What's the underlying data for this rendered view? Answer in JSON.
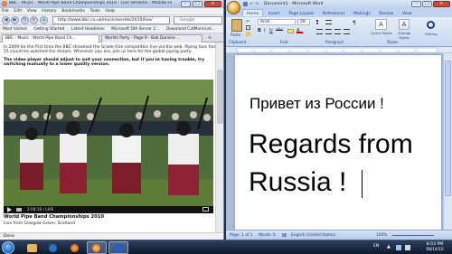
{
  "firefox": {
    "title": "BBC - Music - World Pipe Band Championships 2010 - Live Streams - Mozilla Firefox",
    "menu": [
      "File",
      "Edit",
      "View",
      "History",
      "Bookmarks",
      "Tools",
      "Help"
    ],
    "url": "http://www.bbc.co.uk/music/worlds/2010/live/",
    "search_placeholder": "Google",
    "bookmarks": [
      "Most Visited",
      "Getting Started",
      "Latest Headlines",
      "Microsoft DIA Server 2...",
      "Download CatMomicat..."
    ],
    "tabs": [
      {
        "label": "BBC - Music - World Pipe Band Ch...",
        "active": true
      },
      {
        "label": "Worlds Party - Page 9 - Bob Dunsire ...",
        "active": false
      }
    ],
    "intro_text": "In 2009 for the first time the BBC streamed the Grade One competition live via the web. Piping fans from 55 countries watched the stream. Wherever you are, join us here for the global piping party.",
    "intro_bold": "The video player should adjust to suit your connection, but if you're having trouble, try switching manually to a lower quality version.",
    "video_time": "2:04:16 / LIVE",
    "article_title": "World Pipe Band Championships 2010",
    "article_sub": "Live from Glasgow Green, Scotland",
    "status": "Done"
  },
  "word": {
    "title": "Document1 - Microsoft Word",
    "tabs": [
      "Home",
      "Insert",
      "Page Layout",
      "References",
      "Mailings",
      "Review",
      "View"
    ],
    "active_tab": "Home",
    "ribbon": {
      "font": "Arial",
      "size": "28",
      "paste": "Paste",
      "quick_styles": "Quick Styles",
      "change_styles": "Change Styles",
      "editing": "Editing",
      "groups": [
        "Clipboard",
        "Font",
        "Paragraph",
        "Styles"
      ]
    },
    "doc_lines": [
      "Привет из России !",
      "Regards from",
      "Russia !"
    ],
    "status": {
      "page": "Page: 1 of 1",
      "words": "Words: 6",
      "language": "English (United States)",
      "zoom": "100%"
    }
  },
  "taskbar": {
    "lang": "EN",
    "time": "8:03 PM",
    "date": "08/14/10"
  }
}
